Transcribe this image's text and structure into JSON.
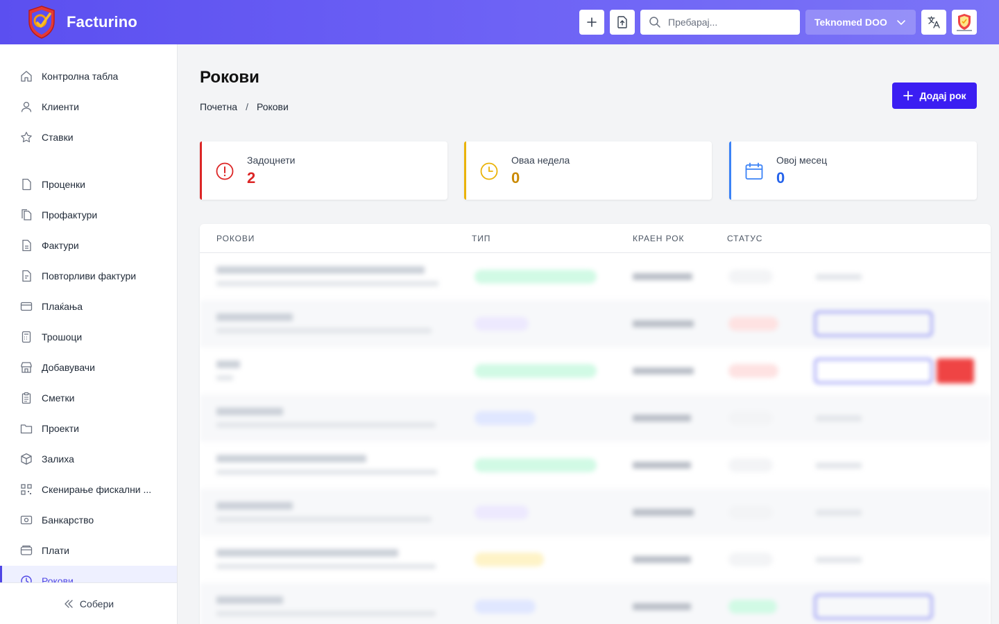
{
  "header": {
    "brand": "Facturino",
    "search_placeholder": "Пребарај...",
    "company": "Teknomed DOO"
  },
  "sidebar": {
    "items": [
      {
        "label": "Контролна табла",
        "icon": "home-icon"
      },
      {
        "label": "Клиенти",
        "icon": "user-icon"
      },
      {
        "label": "Ставки",
        "icon": "star-icon"
      },
      {
        "label": "Проценки",
        "icon": "document-icon"
      },
      {
        "label": "Профактури",
        "icon": "documents-icon"
      },
      {
        "label": "Фактури",
        "icon": "invoice-icon"
      },
      {
        "label": "Повторливи фактури",
        "icon": "recurring-invoice-icon"
      },
      {
        "label": "Плаќања",
        "icon": "credit-card-icon"
      },
      {
        "label": "Трошоци",
        "icon": "calculator-icon"
      },
      {
        "label": "Добавувачи",
        "icon": "store-icon"
      },
      {
        "label": "Сметки",
        "icon": "clipboard-icon"
      },
      {
        "label": "Проекти",
        "icon": "folder-icon"
      },
      {
        "label": "Залиха",
        "icon": "cube-icon"
      },
      {
        "label": "Скенирање фискални ...",
        "icon": "qr-code-icon"
      },
      {
        "label": "Банкарство",
        "icon": "bank-icon"
      },
      {
        "label": "Плати",
        "icon": "wallet-icon"
      },
      {
        "label": "Рокови",
        "icon": "clock-icon",
        "active": true
      }
    ],
    "collapse_label": "Собери"
  },
  "page": {
    "title": "Рокови",
    "breadcrumb": [
      "Почетна",
      "Рокови"
    ],
    "add_button": "Додај рок"
  },
  "stats": [
    {
      "label": "Задоцнети",
      "value": "2",
      "color": "#dc2626",
      "icon": "alert-circle-icon"
    },
    {
      "label": "Оваа недела",
      "value": "0",
      "color": "#ca8a04",
      "icon": "clock-icon"
    },
    {
      "label": "Овој месец",
      "value": "0",
      "color": "#2563eb",
      "icon": "calendar-icon"
    }
  ],
  "table": {
    "headers": [
      "РОКОВИ",
      "ТИП",
      "КРАЕН РОК",
      "СТАТУС"
    ]
  }
}
